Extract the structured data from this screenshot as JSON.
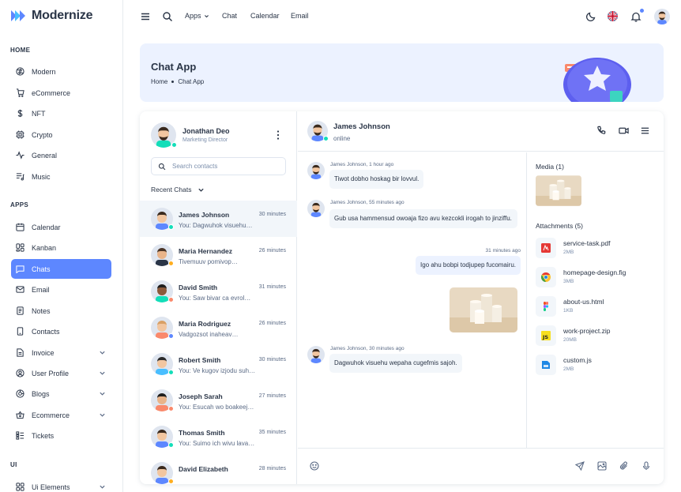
{
  "brand": {
    "name": "Modernize",
    "primary": "#5d87ff"
  },
  "sidebar": {
    "sections": [
      {
        "caption": "HOME",
        "items": [
          {
            "label": "Modern",
            "icon": "aperture-icon"
          },
          {
            "label": "eCommerce",
            "icon": "cart-icon"
          },
          {
            "label": "NFT",
            "icon": "dollar-icon"
          },
          {
            "label": "Crypto",
            "icon": "cpu-icon"
          },
          {
            "label": "General",
            "icon": "activity-icon"
          },
          {
            "label": "Music",
            "icon": "playlist-icon"
          }
        ]
      },
      {
        "caption": "APPS",
        "items": [
          {
            "label": "Calendar",
            "icon": "calendar-icon"
          },
          {
            "label": "Kanban",
            "icon": "kanban-icon"
          },
          {
            "label": "Chats",
            "icon": "message-icon",
            "active": true
          },
          {
            "label": "Email",
            "icon": "mail-icon"
          },
          {
            "label": "Notes",
            "icon": "notes-icon"
          },
          {
            "label": "Contacts",
            "icon": "phone-icon"
          },
          {
            "label": "Invoice",
            "icon": "file-text-icon",
            "has_children": true
          },
          {
            "label": "User Profile",
            "icon": "user-circle-icon",
            "has_children": true
          },
          {
            "label": "Blogs",
            "icon": "chart-donut-icon",
            "has_children": true
          },
          {
            "label": "Ecommerce",
            "icon": "basket-icon",
            "has_children": true
          },
          {
            "label": "Tickets",
            "icon": "ticket-icon"
          }
        ]
      },
      {
        "caption": "UI",
        "items": [
          {
            "label": "Ui Elements",
            "icon": "layout-grid-icon",
            "has_children": true
          }
        ]
      }
    ]
  },
  "topbar": {
    "links": [
      "Apps",
      "Chat",
      "Calendar",
      "Email"
    ]
  },
  "banner": {
    "title": "Chat App",
    "breadcrumb": [
      "Home",
      "Chat App"
    ]
  },
  "chat": {
    "me": {
      "name": "Jonathan Deo",
      "role": "Marketing Director"
    },
    "search_placeholder": "Search contacts",
    "recent_label": "Recent Chats",
    "contacts": [
      {
        "name": "James Johnson",
        "message": "You: Dagwuhok visuehu…",
        "time": "30 minutes",
        "status": "#13deb9",
        "skin": "#f2c6a0",
        "hair": "#3a2a1e",
        "shirt": "#5d87ff"
      },
      {
        "name": "Maria Hernandez",
        "message": "Tivemuuv pomivop…",
        "time": "26 minutes",
        "status": "#ffae1f",
        "skin": "#e9b48a",
        "hair": "#4a3426",
        "shirt": "#2a3547"
      },
      {
        "name": "David Smith",
        "message": "You: Saw bivar ca evrol…",
        "time": "31 minutes",
        "status": "#fa896b",
        "skin": "#8d5a3b",
        "hair": "#1e1e1e",
        "shirt": "#13deb9"
      },
      {
        "name": "Maria Rodriguez",
        "message": "Vadgozsot inaheav…",
        "time": "26 minutes",
        "status": "#5d87ff",
        "skin": "#f2c6a0",
        "hair": "#d9a066",
        "shirt": "#fa896b"
      },
      {
        "name": "Robert Smith",
        "message": "You: Ve kugov izjodu suh…",
        "time": "30 minutes",
        "status": "#13deb9",
        "skin": "#f2c6a0",
        "hair": "#2a2a2a",
        "shirt": "#49beff"
      },
      {
        "name": "Joseph Sarah",
        "message": "You: Esucah wo boakeej…",
        "time": "27 minutes",
        "status": "#fa896b",
        "skin": "#e9b48a",
        "hair": "#1e1e1e",
        "shirt": "#fa896b"
      },
      {
        "name": "Thomas Smith",
        "message": "You: Suimo ich wivu lava…",
        "time": "35 minutes",
        "status": "#13deb9",
        "skin": "#f2c6a0",
        "hair": "#3a2a1e",
        "shirt": "#5d87ff"
      },
      {
        "name": "David Elizabeth",
        "message": "",
        "time": "28 minutes",
        "status": "#ffae1f",
        "skin": "#f2c6a0",
        "hair": "#3a2a1e",
        "shirt": "#5d87ff"
      }
    ],
    "active": {
      "name": "James Johnson",
      "status": "online"
    },
    "messages": [
      {
        "meta": "James Johnson, 1 hour ago",
        "text": "Tiwot dobho hoskag bir lovvul.",
        "mine": false
      },
      {
        "meta": "James Johnson, 55 minutes ago",
        "text": "Gub usa hammensud owoaja fizo avu kezcokli irogah to jinziffu.",
        "mine": false
      },
      {
        "meta": "31 minutes ago",
        "text": "Igo ahu bobpi todjupep fucomairu.",
        "mine": true
      },
      {
        "meta": "James Johnson, 30 minutes ago",
        "text": "Dagwuhok visuehu wepaha cugefmis sajoh.",
        "mine": false
      }
    ],
    "media_label": "Media (1)",
    "attachments_label": "Attachments (5)",
    "attachments": [
      {
        "name": "service-task.pdf",
        "size": "2MB",
        "icon": "pdf-icon"
      },
      {
        "name": "homepage-design.fig",
        "size": "3MB",
        "icon": "chrome-icon"
      },
      {
        "name": "about-us.html",
        "size": "1KB",
        "icon": "figma-icon"
      },
      {
        "name": "work-project.zip",
        "size": "20MB",
        "icon": "js-icon"
      },
      {
        "name": "custom.js",
        "size": "2MB",
        "icon": "zip-icon"
      }
    ]
  }
}
